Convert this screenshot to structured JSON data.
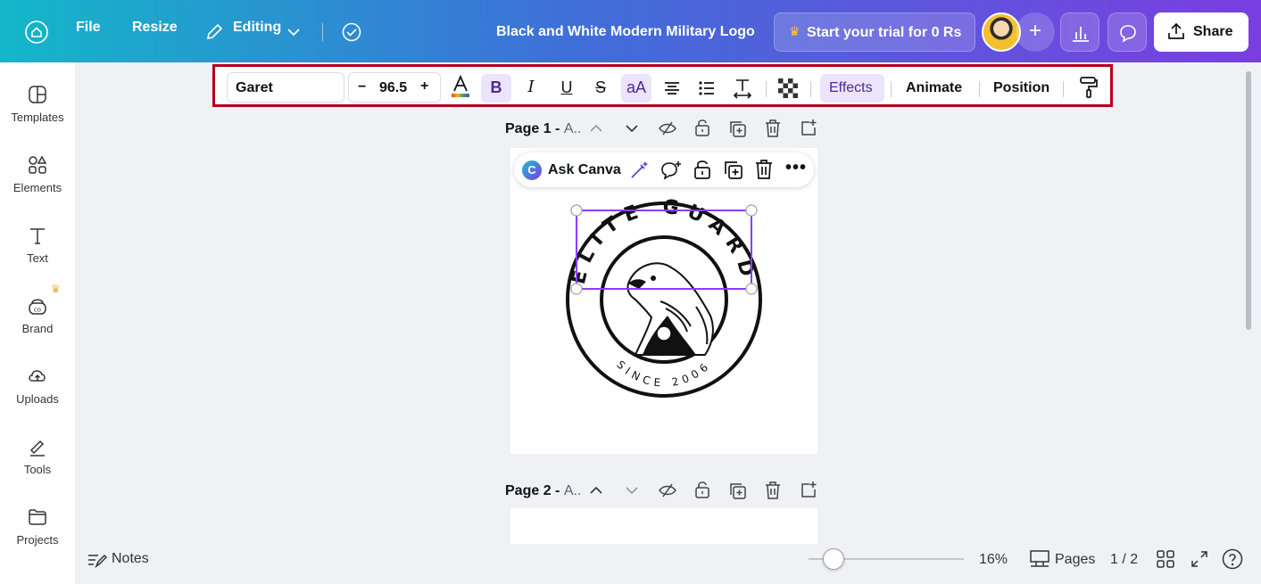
{
  "header": {
    "file_label": "File",
    "resize_label": "Resize",
    "editing_label": "Editing",
    "doc_title": "Black and White Modern Military Logo",
    "trial_label": "Start your trial for 0 Rs",
    "share_label": "Share"
  },
  "sidebar": {
    "items": [
      {
        "label": "Templates",
        "icon": "templates-icon"
      },
      {
        "label": "Elements",
        "icon": "elements-icon"
      },
      {
        "label": "Text",
        "icon": "text-icon"
      },
      {
        "label": "Brand",
        "icon": "brand-icon"
      },
      {
        "label": "Uploads",
        "icon": "uploads-icon"
      },
      {
        "label": "Tools",
        "icon": "tools-icon"
      },
      {
        "label": "Projects",
        "icon": "projects-icon"
      }
    ]
  },
  "toolbar": {
    "font_name": "Garet",
    "font_size": "96.5",
    "minus": "−",
    "plus": "+",
    "bold": "B",
    "italic": "I",
    "underline": "U",
    "strikethrough": "S",
    "case": "aA",
    "effects_label": "Effects",
    "animate_label": "Animate",
    "position_label": "Position"
  },
  "canvas": {
    "page1_name": "Page 1 - ",
    "page1_sub": "A..",
    "page2_name": "Page 2 - ",
    "page2_sub": "A..",
    "ask_canva_label": "Ask Canva",
    "logo": {
      "top_text": "ELITE GUARD",
      "bottom_text": "SINCE 2006"
    }
  },
  "footer": {
    "notes_label": "Notes",
    "zoom": "16%",
    "zoom_fraction": 0.16,
    "pages_label": "Pages",
    "pages_count": "1 / 2"
  },
  "colors": {
    "header_start": "#13b7c9",
    "header_end": "#7a3ee0",
    "highlight_frame": "#b3001b",
    "selection": "#8b3dff"
  }
}
